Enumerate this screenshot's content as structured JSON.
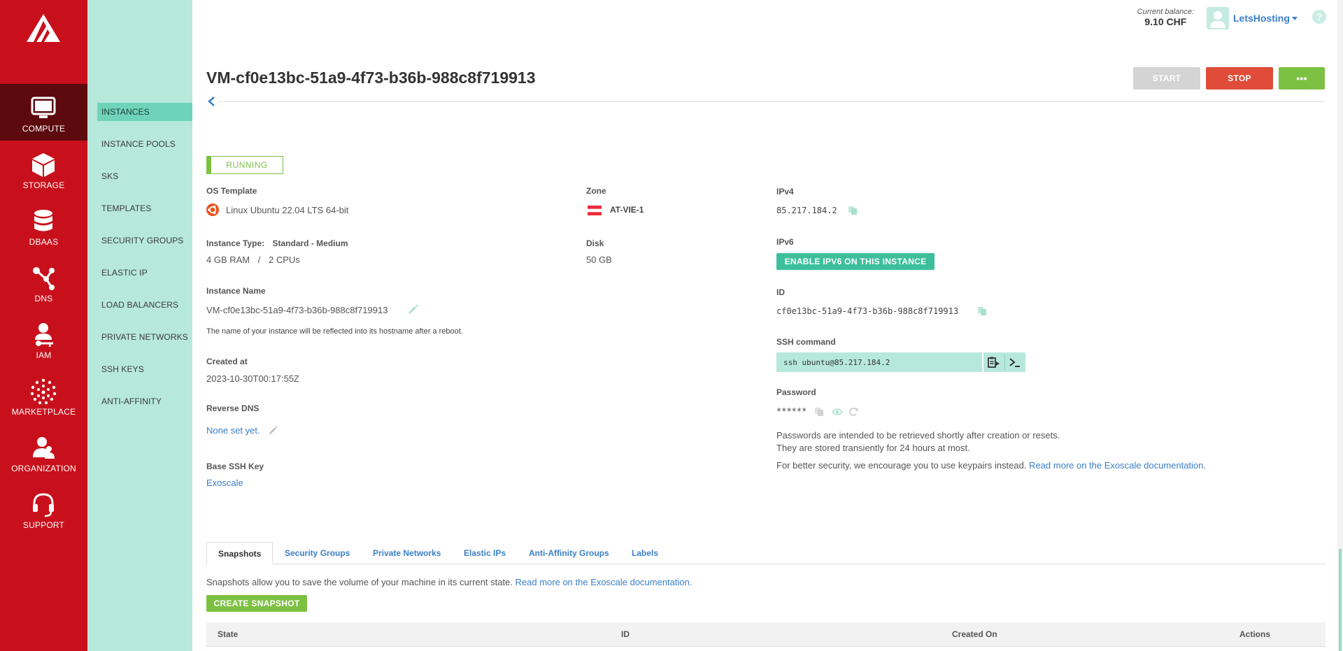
{
  "nav": {
    "items": [
      {
        "label": "COMPUTE",
        "icon": "monitor-icon",
        "active": true
      },
      {
        "label": "STORAGE",
        "icon": "cube-icon"
      },
      {
        "label": "DBAAS",
        "icon": "database-icon"
      },
      {
        "label": "DNS",
        "icon": "network-nodes-icon"
      },
      {
        "label": "IAM",
        "icon": "user-key-icon"
      },
      {
        "label": "MARKETPLACE",
        "icon": "dots-circle-icon"
      },
      {
        "label": "ORGANIZATION",
        "icon": "users-icon"
      },
      {
        "label": "SUPPORT",
        "icon": "headset-icon"
      }
    ]
  },
  "subnav": {
    "items": [
      {
        "label": "INSTANCES",
        "active": true
      },
      {
        "label": "INSTANCE POOLS"
      },
      {
        "label": "SKS"
      },
      {
        "label": "TEMPLATES"
      },
      {
        "label": "SECURITY GROUPS"
      },
      {
        "label": "ELASTIC IP"
      },
      {
        "label": "LOAD BALANCERS"
      },
      {
        "label": "PRIVATE NETWORKS"
      },
      {
        "label": "SSH KEYS"
      },
      {
        "label": "ANTI-AFFINITY"
      }
    ]
  },
  "topbar": {
    "balance_caption": "Current balance:",
    "balance_amount": "9.10 CHF",
    "username": "LetsHosting",
    "help": "?"
  },
  "instance": {
    "title": "VM-cf0e13bc-51a9-4f73-b36b-988c8f719913",
    "start_label": "START",
    "stop_label": "STOP",
    "more_label": "•••",
    "status": "RUNNING",
    "os_template_label": "OS Template",
    "os_template": "Linux Ubuntu 22.04 LTS 64-bit",
    "instance_type_label": "Instance Type:",
    "instance_type": "Standard - Medium",
    "ram": "4 GB RAM",
    "sep": "/",
    "cpus": "2 CPUs",
    "name_label": "Instance Name",
    "name": "VM-cf0e13bc-51a9-4f73-b36b-988c8f719913",
    "name_hint": "The name of your instance will be reflected into its hostname after a reboot.",
    "created_label": "Created at",
    "created": "2023-10-30T00:17:55Z",
    "rdns_label": "Reverse DNS",
    "rdns": "None set yet.",
    "sshkey_label": "Base SSH Key",
    "sshkey": "Exoscale",
    "zone_label": "Zone",
    "zone": "AT-VIE-1",
    "disk_label": "Disk",
    "disk": "50 GB",
    "ipv4_label": "IPv4",
    "ipv4": "85.217.184.2",
    "ipv6_label": "IPv6",
    "ipv6_button": "ENABLE IPV6 ON THIS INSTANCE",
    "id_label": "ID",
    "id": "cf0e13bc-51a9-4f73-b36b-988c8f719913",
    "ssh_label": "SSH command",
    "ssh": "ssh ubuntu@85.217.184.2",
    "password_label": "Password",
    "password": "******",
    "pw_note1": "Passwords are intended to be retrieved shortly after creation or resets.",
    "pw_note2": "They are stored transiently for 24 hours at most.",
    "pw_note3": "For better security, we encourage you to use keypairs instead.",
    "pw_link": "Read more on the Exoscale documentation."
  },
  "tabs": [
    {
      "label": "Snapshots",
      "active": true
    },
    {
      "label": "Security Groups"
    },
    {
      "label": "Private Networks"
    },
    {
      "label": "Elastic IPs"
    },
    {
      "label": "Anti-Affinity Groups"
    },
    {
      "label": "Labels"
    }
  ],
  "snapshots": {
    "description": "Snapshots allow you to save the volume of your machine in its current state.",
    "doc_link": "Read more on the Exoscale documentation.",
    "create_label": "CREATE SNAPSHOT",
    "columns": [
      "State",
      "ID",
      "Created On",
      "Actions"
    ]
  },
  "colors": {
    "brand_red": "#c8101c",
    "subnav_bg": "#b7e8dc",
    "green": "#7dc143",
    "teal": "#3dbf9c",
    "danger": "#e04c37",
    "link": "#3a7fc8"
  }
}
